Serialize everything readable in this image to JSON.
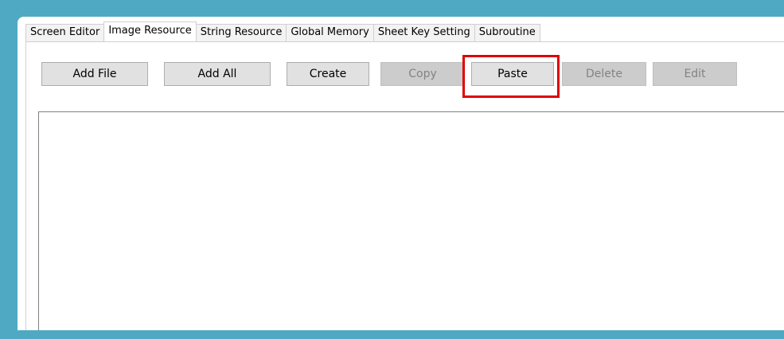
{
  "tabs": [
    {
      "label": "Screen Editor",
      "active": false
    },
    {
      "label": "Image Resource",
      "active": true
    },
    {
      "label": "String Resource",
      "active": false
    },
    {
      "label": "Global Memory",
      "active": false
    },
    {
      "label": "Sheet Key Setting",
      "active": false
    },
    {
      "label": "Subroutine",
      "active": false
    }
  ],
  "toolbar": {
    "add_file": "Add File",
    "add_all": "Add All",
    "create": "Create",
    "copy": "Copy",
    "paste": "Paste",
    "delete": "Delete",
    "edit": "Edit"
  },
  "button_states": {
    "copy": "disabled",
    "delete": "disabled",
    "edit": "disabled"
  },
  "highlighted_button": "Paste",
  "colors": {
    "background": "#4fa9c2",
    "highlight": "#e00000"
  }
}
